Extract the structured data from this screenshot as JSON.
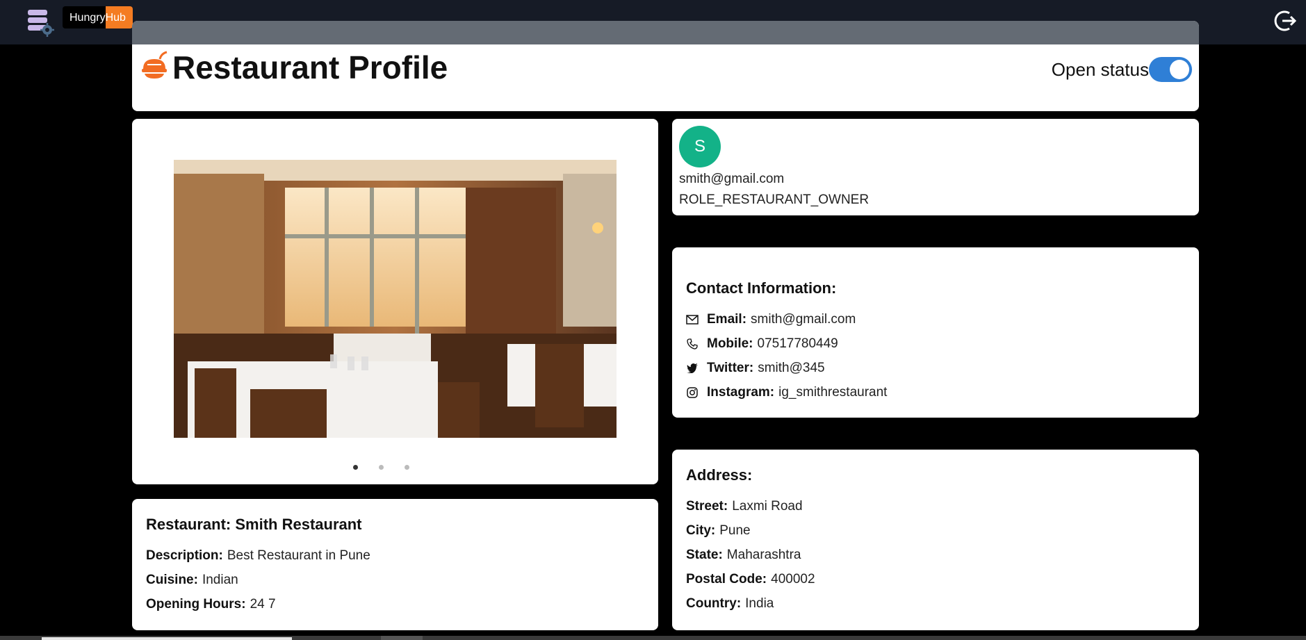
{
  "brand": {
    "part1": "Hungry",
    "part2": "Hub",
    "accent": "#f47c22"
  },
  "header": {
    "title": "Restaurant Profile",
    "open_status_label": "Open status",
    "open_status_on": true,
    "toggle_color": "#2f7fd6"
  },
  "carousel": {
    "slides": 3,
    "active": 1
  },
  "user": {
    "initial": "S",
    "email": "smith@gmail.com",
    "role": "ROLE_RESTAURANT_OWNER",
    "avatar_color": "#13b288"
  },
  "contact": {
    "heading": "Contact Information:",
    "email_label": "Email:",
    "email": "smith@gmail.com",
    "mobile_label": "Mobile:",
    "mobile": "07517780449",
    "twitter_label": "Twitter:",
    "twitter": "smith@345",
    "instagram_label": "Instagram:",
    "instagram": "ig_smithrestaurant"
  },
  "address": {
    "heading": "Address:",
    "street_label": "Street:",
    "street": "Laxmi Road",
    "city_label": "City:",
    "city": "Pune",
    "state_label": "State:",
    "state": "Maharashtra",
    "postal_label": "Postal Code:",
    "postal": "400002",
    "country_label": "Country:",
    "country": "India"
  },
  "restaurant": {
    "heading": "Restaurant: Smith Restaurant",
    "description_label": "Description:",
    "description": "Best Restaurant in Pune",
    "cuisine_label": "Cuisine:",
    "cuisine": "Indian",
    "hours_label": "Opening Hours:",
    "hours": "24 7"
  },
  "icons": {
    "menu": "menu-settings-icon",
    "logout": "logout-icon",
    "logo": "restaurant-logo-icon",
    "email": "mail-icon",
    "mobile": "phone-icon",
    "twitter": "twitter-icon",
    "instagram": "instagram-icon"
  }
}
